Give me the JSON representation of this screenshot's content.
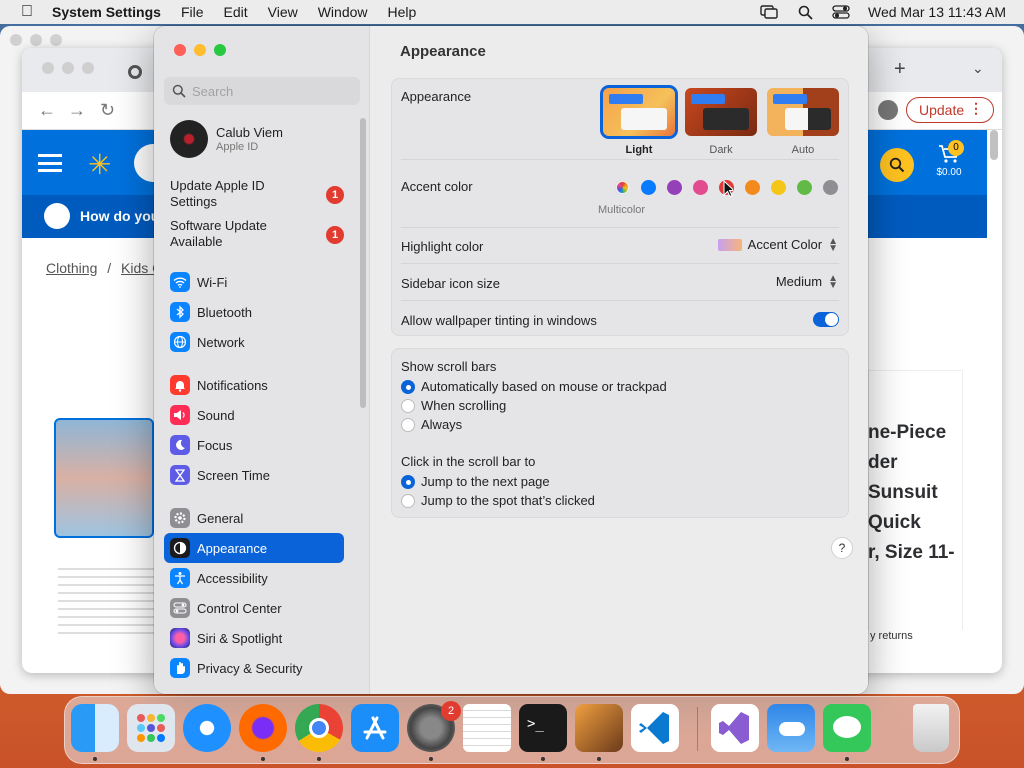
{
  "menubar": {
    "app_name": "System Settings",
    "menus": [
      "File",
      "Edit",
      "View",
      "Window",
      "Help"
    ],
    "datetime": "Wed Mar 13  11:43 AM"
  },
  "browser": {
    "update_label": "Update",
    "promo_text": "How do you",
    "breadcrumb_1": "Clothing",
    "breadcrumb_sep": "/",
    "breadcrumb_2": "Kids C",
    "cart_count": "0",
    "cart_total": "$0.00",
    "product_title": "ne-Piece\nder\nSunsuit\nQuick\nr, Size 11-",
    "returns_text": "y returns"
  },
  "settings": {
    "search_placeholder": "Search",
    "account": {
      "name": "Calub Viem",
      "sub": "Apple ID"
    },
    "notices": [
      {
        "label": "Update Apple ID Settings",
        "badge": "1"
      },
      {
        "label": "Software Update Available",
        "badge": "1"
      }
    ],
    "sidebar": [
      {
        "label": "Wi-Fi",
        "icon": "wifi-icon",
        "color": "#0a84ff"
      },
      {
        "label": "Bluetooth",
        "icon": "bluetooth-icon",
        "color": "#0a84ff"
      },
      {
        "label": "Network",
        "icon": "globe-icon",
        "color": "#0a84ff"
      },
      {
        "label": "Notifications",
        "icon": "bell-icon",
        "color": "#ff3b30"
      },
      {
        "label": "Sound",
        "icon": "speaker-icon",
        "color": "#ff2d55"
      },
      {
        "label": "Focus",
        "icon": "moon-icon",
        "color": "#5e5ce6"
      },
      {
        "label": "Screen Time",
        "icon": "hourglass-icon",
        "color": "#5e5ce6"
      },
      {
        "label": "General",
        "icon": "gear-icon",
        "color": "#8e8e93"
      },
      {
        "label": "Appearance",
        "icon": "appearance-icon",
        "color": "#1c1c1e"
      },
      {
        "label": "Accessibility",
        "icon": "accessibility-icon",
        "color": "#0a84ff"
      },
      {
        "label": "Control Center",
        "icon": "control-center-icon",
        "color": "#8e8e93"
      },
      {
        "label": "Siri & Spotlight",
        "icon": "siri-icon",
        "color": "#5e5ce6"
      },
      {
        "label": "Privacy & Security",
        "icon": "hand-icon",
        "color": "#0a84ff"
      }
    ],
    "selected_item": "Appearance",
    "page_title": "Appearance",
    "appearance": {
      "label": "Appearance",
      "options": [
        "Light",
        "Dark",
        "Auto"
      ],
      "selected": "Light"
    },
    "accent": {
      "label": "Accent color",
      "colors": [
        "#c64fbd",
        "#0a7aff",
        "#9440b8",
        "#e24b8f",
        "#e13a3a",
        "#f28b1c",
        "#f5c518",
        "#62ba46",
        "#8e8e93"
      ],
      "selected_name": "Multicolor"
    },
    "highlight": {
      "label": "Highlight color",
      "value": "Accent Color"
    },
    "sidebar_icon_size": {
      "label": "Sidebar icon size",
      "value": "Medium"
    },
    "wallpaper_tinting": {
      "label": "Allow wallpaper tinting in windows",
      "enabled": true
    },
    "scroll_bars": {
      "label": "Show scroll bars",
      "options": [
        "Automatically based on mouse or trackpad",
        "When scrolling",
        "Always"
      ],
      "selected_index": 0
    },
    "click_scroll": {
      "label": "Click in the scroll bar to",
      "options": [
        "Jump to the next page",
        "Jump to the spot that’s clicked"
      ],
      "selected_index": 0
    },
    "help_label": "?"
  },
  "dock": {
    "apps": [
      "Finder",
      "Launchpad",
      "Safari",
      "Firefox",
      "Chrome",
      "App Store",
      "System Settings",
      "TextEdit",
      "Terminal",
      "GarageBand",
      "VS Code",
      "Visual Studio",
      "Weather",
      "Messages",
      "Trash"
    ],
    "system_settings_badge": "2"
  }
}
